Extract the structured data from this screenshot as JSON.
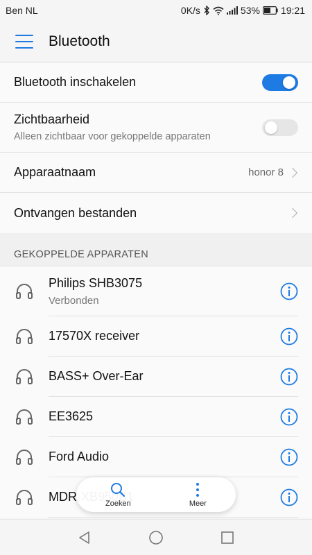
{
  "status_bar": {
    "carrier": "Ben NL",
    "net_speed": "0K/s",
    "battery": "53%",
    "time": "19:21"
  },
  "app_bar": {
    "title": "Bluetooth",
    "menu_icon": "hamburger-icon"
  },
  "settings": {
    "bluetooth_enable": {
      "label": "Bluetooth inschakelen",
      "on": true
    },
    "visibility": {
      "label": "Zichtbaarheid",
      "sub": "Alleen zichtbaar voor gekoppelde apparaten",
      "on": false
    },
    "device_name": {
      "label": "Apparaatnaam",
      "value": "honor 8"
    },
    "received_files": {
      "label": "Ontvangen bestanden"
    }
  },
  "paired_section": {
    "header": "GEKOPPELDE APPARATEN",
    "devices": [
      {
        "name": "Philips SHB3075",
        "status": "Verbonden"
      },
      {
        "name": "17570X receiver"
      },
      {
        "name": "BASS+ Over-Ear"
      },
      {
        "name": "EE3625"
      },
      {
        "name": "Ford Audio"
      },
      {
        "name": "MDR-XB950B1"
      }
    ]
  },
  "floating_bar": {
    "search_label": "Zoeken",
    "more_label": "Meer"
  },
  "nav_bar": {
    "back_icon": "back-triangle-icon",
    "home_icon": "home-circle-icon",
    "recents_icon": "recents-square-icon"
  },
  "colors": {
    "accent": "#1e7be3"
  }
}
